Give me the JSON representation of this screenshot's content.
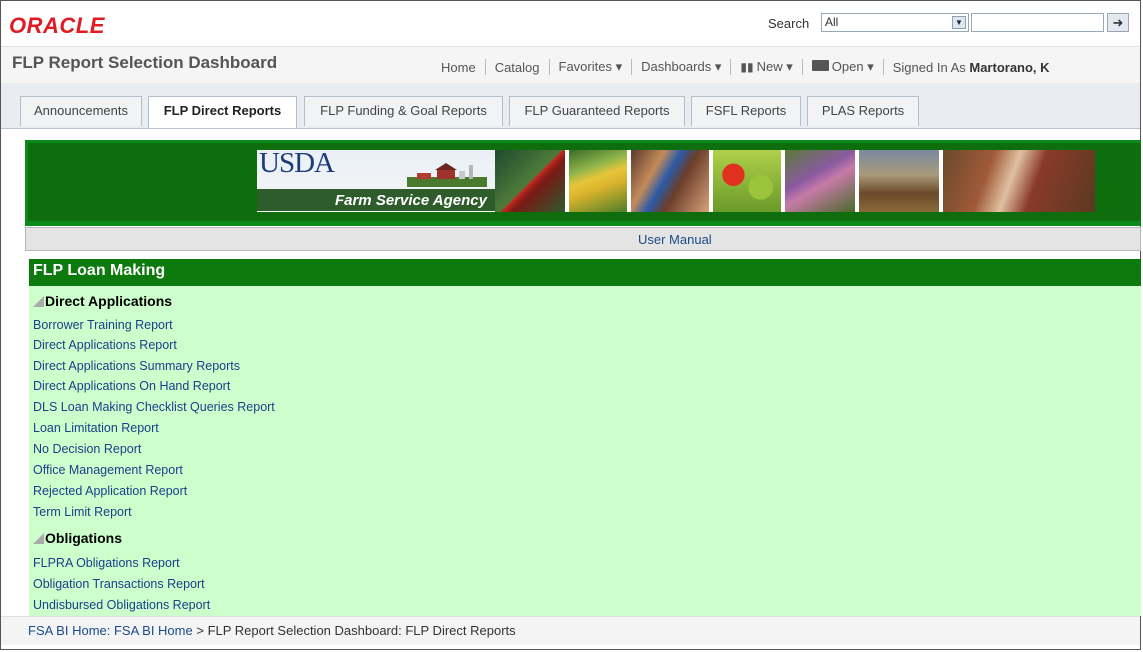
{
  "app": {
    "logo": "ORACLE"
  },
  "search": {
    "label": "Search",
    "scope_value": "All",
    "input_value": ""
  },
  "header": {
    "title": "FLP Report Selection Dashboard",
    "nav": {
      "home": "Home",
      "catalog": "Catalog",
      "favorites": "Favorites",
      "dashboards": "Dashboards",
      "new": "New",
      "open": "Open",
      "signed_in_label": "Signed In As",
      "signed_in_user": "Martorano, K"
    }
  },
  "tabs": [
    {
      "label": "Announcements",
      "active": false
    },
    {
      "label": "FLP Direct Reports",
      "active": true
    },
    {
      "label": "FLP Funding & Goal Reports",
      "active": false
    },
    {
      "label": "FLP Guaranteed Reports",
      "active": false
    },
    {
      "label": "FSFL Reports",
      "active": false
    },
    {
      "label": "PLAS Reports",
      "active": false
    }
  ],
  "banner": {
    "usda": "USDA",
    "agency": "Farm Service Agency"
  },
  "user_manual": "User Manual",
  "section": {
    "title": "FLP Loan Making",
    "groups": [
      {
        "title": "Direct Applications",
        "links": [
          "Borrower Training Report",
          "Direct Applications Report",
          "Direct Applications Summary Reports",
          "Direct Applications On Hand Report",
          "DLS Loan Making Checklist Queries Report",
          "Loan Limitation Report",
          "No Decision Report",
          "Office Management Report",
          "Rejected Application Report",
          "Term Limit Report"
        ]
      },
      {
        "title": "Obligations",
        "links": [
          "FLPRA Obligations Report",
          "Obligation Transactions Report",
          "Undisbursed Obligations Report"
        ]
      }
    ]
  },
  "breadcrumb": {
    "home": "FSA BI Home: FSA BI Home",
    "separator": ">",
    "current": "FLP Report Selection Dashboard: FLP Direct Reports"
  },
  "colors": {
    "oracle_red": "#e01b22",
    "section_green": "#0d7a0d",
    "content_bg": "#ccffcc",
    "link_blue": "#1b3f8a"
  }
}
